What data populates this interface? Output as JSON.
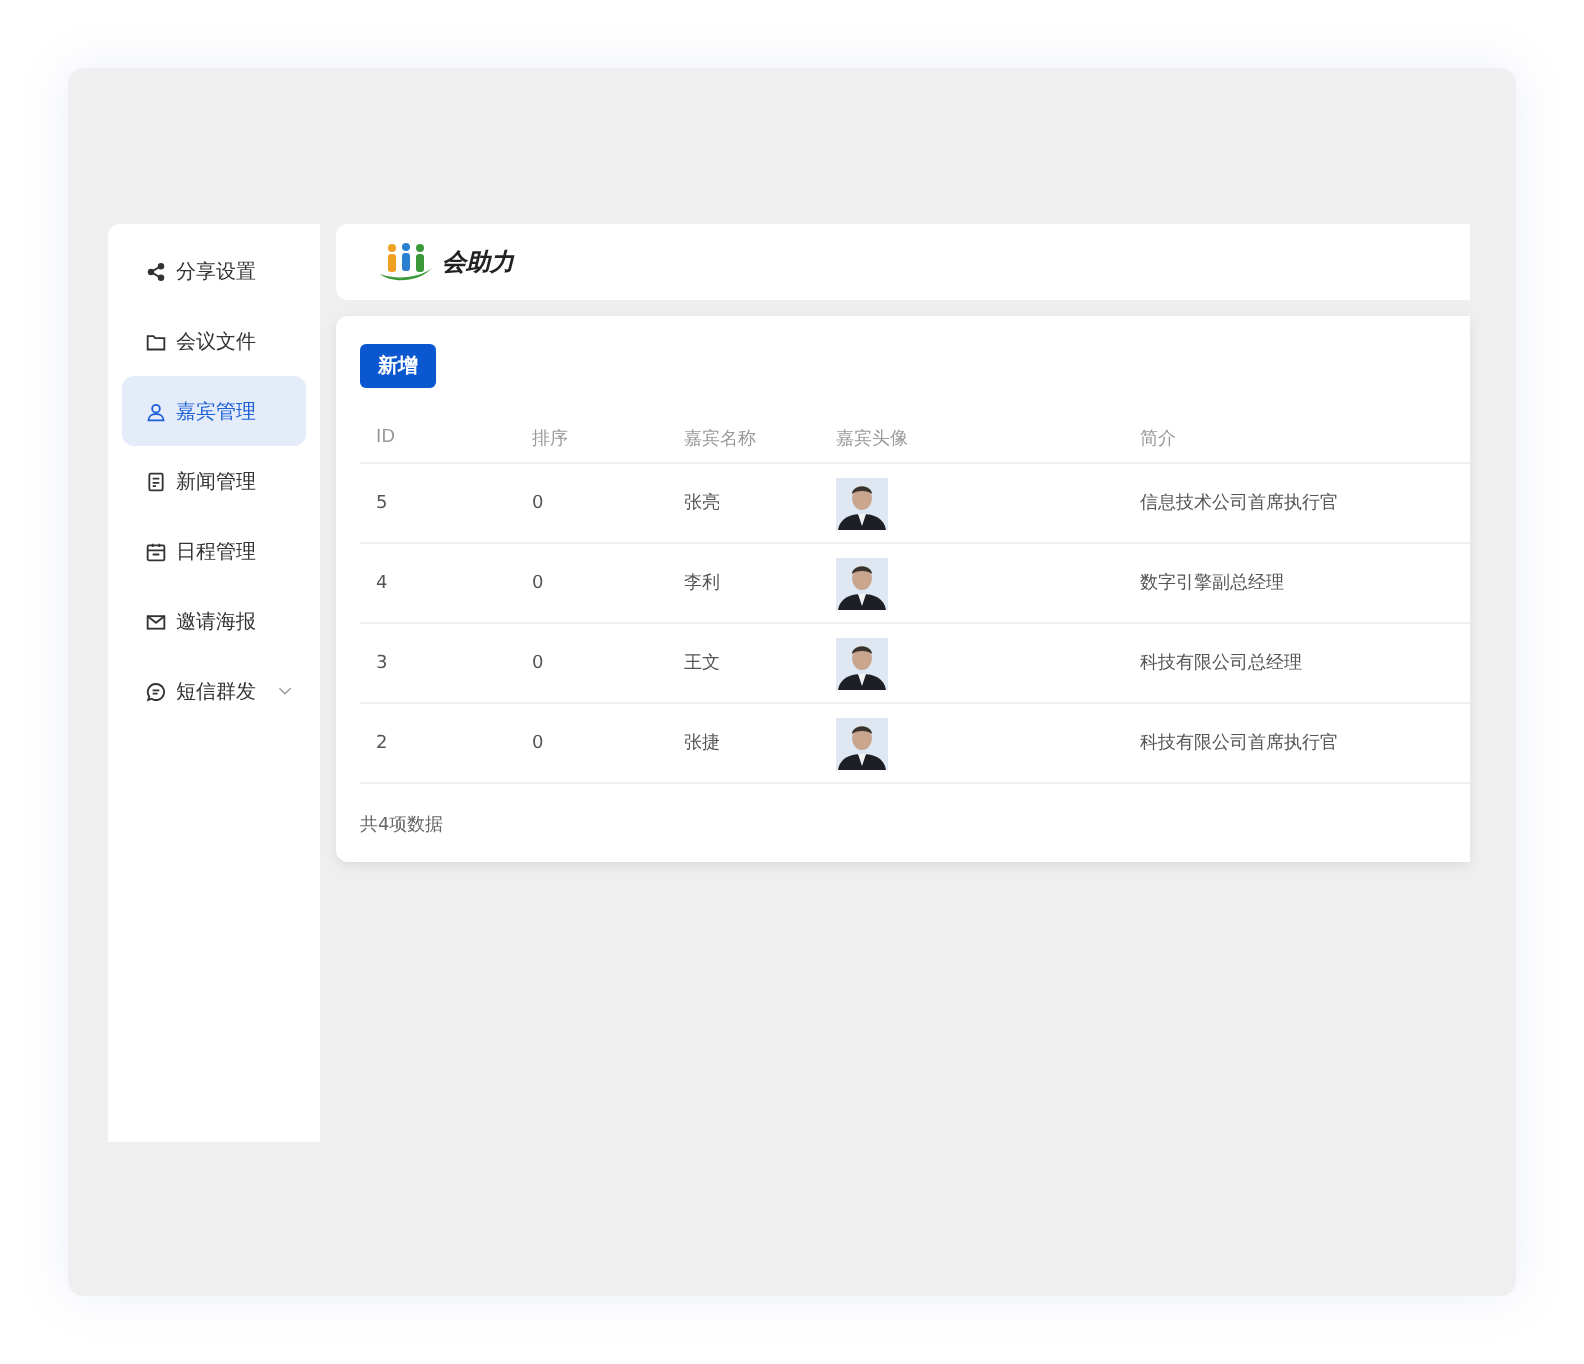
{
  "sidebar": {
    "items": [
      {
        "label": "分享设置",
        "selected": false
      },
      {
        "label": "会议文件",
        "selected": false
      },
      {
        "label": "嘉宾管理",
        "selected": true
      },
      {
        "label": "新闻管理",
        "selected": false
      },
      {
        "label": "日程管理",
        "selected": false
      },
      {
        "label": "邀请海报",
        "selected": false
      },
      {
        "label": "短信群发",
        "selected": false,
        "expanded": false
      }
    ]
  },
  "header": {
    "logo_text": "会助力"
  },
  "toolbar": {
    "add_button": "新增"
  },
  "table": {
    "columns": [
      "ID",
      "排序",
      "嘉宾名称",
      "嘉宾头像",
      "简介"
    ],
    "rows": [
      {
        "id": "5",
        "order": "0",
        "name": "张亮",
        "intro": "信息技术公司首席执行官"
      },
      {
        "id": "4",
        "order": "0",
        "name": "李利",
        "intro": "数字引擎副总经理"
      },
      {
        "id": "3",
        "order": "0",
        "name": "王文",
        "intro": "科技有限公司总经理"
      },
      {
        "id": "2",
        "order": "0",
        "name": "张捷",
        "intro": "科技有限公司首席执行官"
      }
    ]
  },
  "footer": {
    "total": "共4项数据"
  }
}
